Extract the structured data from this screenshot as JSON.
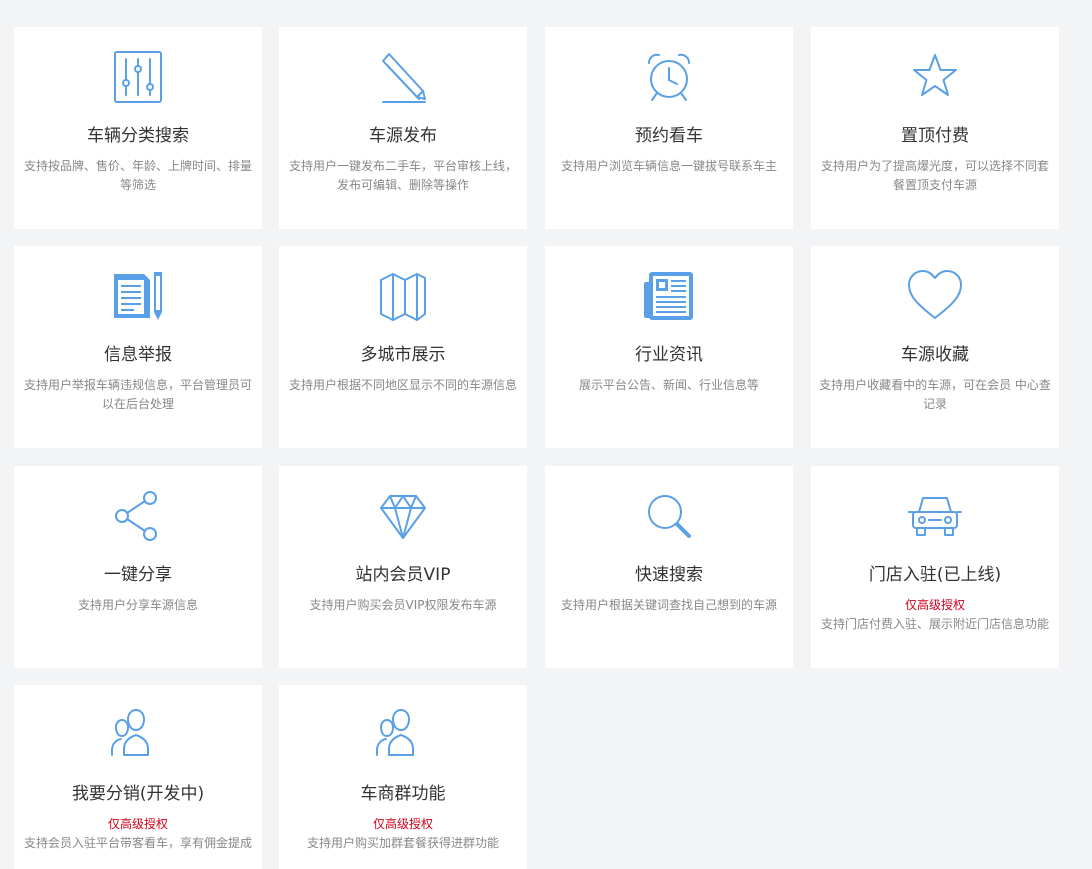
{
  "accent_color": "#5aa0e6",
  "badge_color": "#d0021b",
  "features": [
    {
      "icon": "sliders-icon",
      "title": "车辆分类搜索",
      "desc_lines": [
        "支持按品牌、售价、年龄、上牌时间、排量",
        "等筛选"
      ]
    },
    {
      "icon": "pencil-icon",
      "title": "车源发布",
      "desc_lines": [
        "支持用户一键发布二手车，平台审核上线，",
        "发布可编辑、删除等操作"
      ]
    },
    {
      "icon": "alarm-clock-icon",
      "title": "预约看车",
      "desc_lines": [
        "支持用户浏览车辆信息一键拔号联系车主"
      ]
    },
    {
      "icon": "star-icon",
      "title": "置顶付费",
      "desc_lines": [
        "支持用户为了提高爆光度，可以选择不同套",
        "餐置顶支付车源"
      ]
    },
    {
      "icon": "document-pen-icon",
      "title": "信息举报",
      "desc_lines": [
        "支持用户举报车辆违规信息，平台管理员可",
        "以在后台处理"
      ]
    },
    {
      "icon": "map-icon",
      "title": "多城市展示",
      "desc_lines": [
        "支持用户根据不同地区显示不同的车源信息"
      ]
    },
    {
      "icon": "newspaper-icon",
      "title": "行业资讯",
      "desc_lines": [
        "展示平台公告、新闻、行业信息等"
      ]
    },
    {
      "icon": "heart-icon",
      "title": "车源收藏",
      "desc_lines": [
        "支持用户收藏看中的车源，可在会员 中心查",
        "记录"
      ]
    },
    {
      "icon": "share-icon",
      "title": "一键分享",
      "desc_lines": [
        "支持用户分享车源信息"
      ]
    },
    {
      "icon": "diamond-icon",
      "title": "站内会员VIP",
      "desc_lines": [
        "支持用户购买会员VIP权限发布车源"
      ]
    },
    {
      "icon": "search-icon",
      "title": "快速搜索",
      "desc_lines": [
        "支持用户根据关键词查找自己想到的车源"
      ]
    },
    {
      "icon": "car-icon",
      "title": "门店入驻(已上线)",
      "badge": "仅高级授权",
      "desc_lines": [
        "支持门店付费入驻、展示附近门店信息功能"
      ]
    },
    {
      "icon": "users-icon",
      "title": "我要分销(开发中)",
      "badge": "仅高级授权",
      "desc_lines": [
        "支持会员入驻平台带客看车，享有佣金提成"
      ]
    },
    {
      "icon": "users-icon",
      "title": "车商群功能",
      "badge": "仅高级授权",
      "desc_lines": [
        "支持用户购买加群套餐获得进群功能"
      ]
    }
  ]
}
